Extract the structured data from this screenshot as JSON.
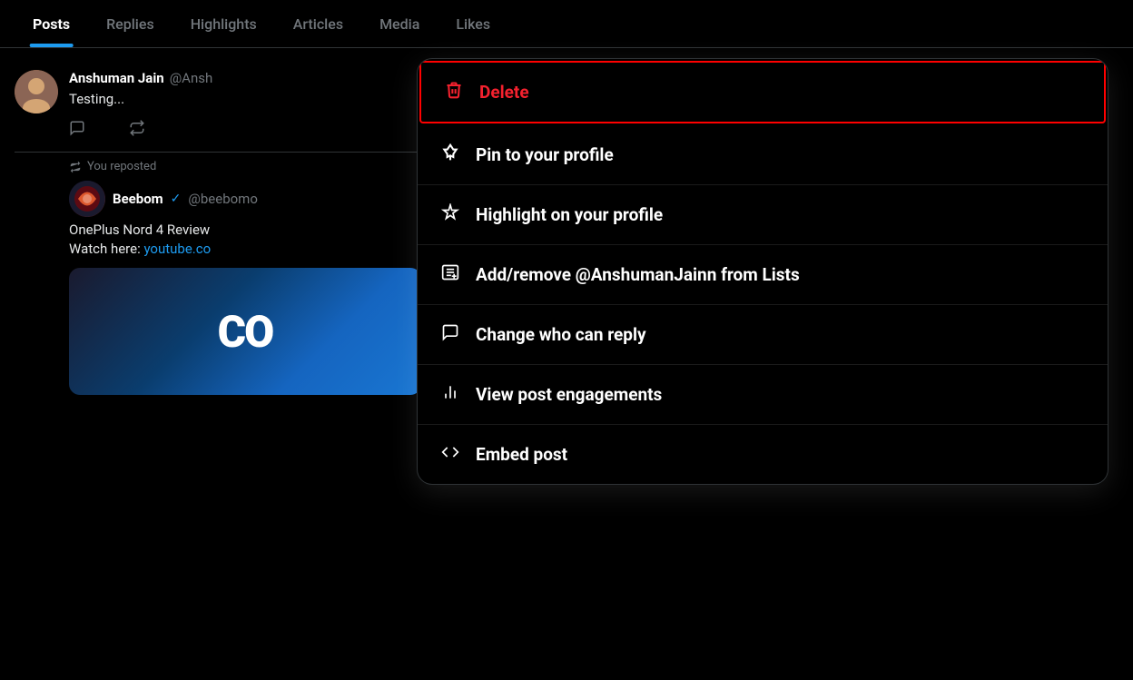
{
  "tabs": [
    {
      "id": "posts",
      "label": "Posts",
      "active": true
    },
    {
      "id": "replies",
      "label": "Replies",
      "active": false
    },
    {
      "id": "highlights",
      "label": "Highlights",
      "active": false
    },
    {
      "id": "articles",
      "label": "Articles",
      "active": false
    },
    {
      "id": "media",
      "label": "Media",
      "active": false
    },
    {
      "id": "likes",
      "label": "Likes",
      "active": false
    }
  ],
  "post1": {
    "author": "Anshuman Jain",
    "handle": "@Ansh",
    "text": "Testing...",
    "reply_icon": "💬",
    "retweet_icon": "🔁"
  },
  "post2": {
    "repost_label": "You reposted",
    "author": "Beebom",
    "handle": "@beebomo",
    "text_line1": "OnePlus Nord 4 Review",
    "text_line2": "Watch here: youtube.co",
    "link_text": "youtube.co"
  },
  "image_preview": {
    "text": "CO"
  },
  "context_menu": {
    "items": [
      {
        "id": "delete",
        "icon_type": "trash",
        "label": "Delete",
        "color": "red",
        "highlighted": true
      },
      {
        "id": "pin",
        "icon_type": "pin",
        "label": "Pin to your profile",
        "color": "white"
      },
      {
        "id": "highlight",
        "icon_type": "sparkle",
        "label": "Highlight on your profile",
        "color": "white"
      },
      {
        "id": "add-list",
        "icon_type": "list",
        "label": "Add/remove @AnshumanJainn from Lists",
        "color": "white"
      },
      {
        "id": "reply",
        "icon_type": "reply",
        "label": "Change who can reply",
        "color": "white"
      },
      {
        "id": "engagements",
        "icon_type": "chart",
        "label": "View post engagements",
        "color": "white"
      },
      {
        "id": "embed",
        "icon_type": "embed",
        "label": "Embed post",
        "color": "white"
      }
    ]
  }
}
